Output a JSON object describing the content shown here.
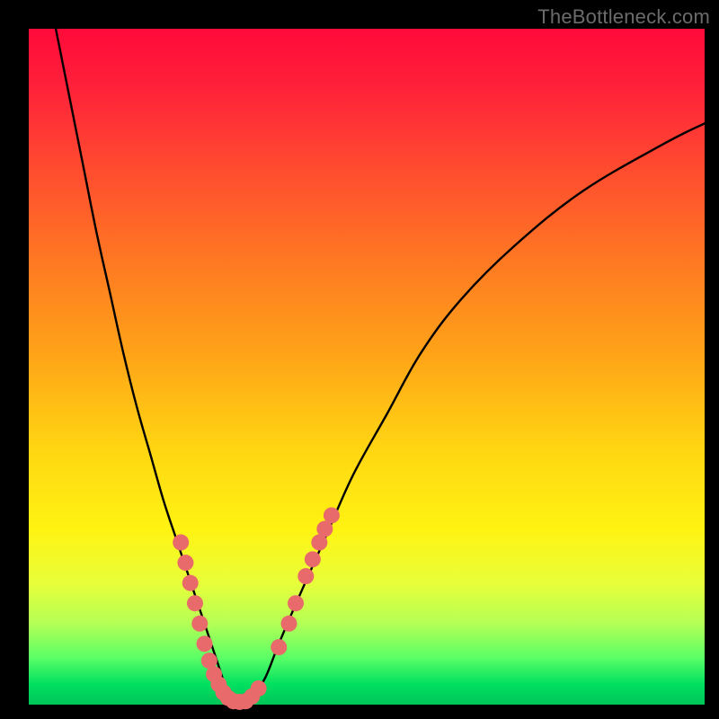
{
  "watermark": "TheBottleneck.com",
  "chart_data": {
    "type": "line",
    "title": "",
    "xlabel": "",
    "ylabel": "",
    "xlim": [
      0,
      100
    ],
    "ylim": [
      0,
      100
    ],
    "series": [
      {
        "name": "bottleneck-curve",
        "x": [
          4,
          6,
          8,
          10,
          12,
          14,
          16,
          18,
          20,
          22,
          24,
          26,
          27,
          28,
          29,
          30,
          31,
          32,
          33,
          35,
          37,
          40,
          44,
          48,
          53,
          58,
          64,
          72,
          82,
          94,
          100
        ],
        "y": [
          100,
          90,
          80,
          70,
          61,
          52,
          44,
          37,
          30,
          24,
          18,
          12,
          9,
          6,
          3,
          1,
          0,
          0,
          1,
          4,
          9,
          16,
          25,
          34,
          43,
          52,
          60,
          68,
          76,
          83,
          86
        ]
      }
    ],
    "markers": {
      "name": "highlight-dots",
      "color": "#e96a6a",
      "radius_px": 9,
      "points": [
        {
          "x": 22.5,
          "y": 24
        },
        {
          "x": 23.2,
          "y": 21
        },
        {
          "x": 23.9,
          "y": 18
        },
        {
          "x": 24.6,
          "y": 15
        },
        {
          "x": 25.3,
          "y": 12
        },
        {
          "x": 26.0,
          "y": 9
        },
        {
          "x": 26.7,
          "y": 6.5
        },
        {
          "x": 27.4,
          "y": 4.5
        },
        {
          "x": 28.1,
          "y": 3
        },
        {
          "x": 28.8,
          "y": 1.8
        },
        {
          "x": 29.5,
          "y": 1
        },
        {
          "x": 30.3,
          "y": 0.5
        },
        {
          "x": 31.2,
          "y": 0.4
        },
        {
          "x": 32.1,
          "y": 0.5
        },
        {
          "x": 33.0,
          "y": 1.2
        },
        {
          "x": 34.0,
          "y": 2.4
        },
        {
          "x": 37.0,
          "y": 8.5
        },
        {
          "x": 38.5,
          "y": 12
        },
        {
          "x": 39.5,
          "y": 15
        },
        {
          "x": 41.0,
          "y": 19
        },
        {
          "x": 42.0,
          "y": 21.5
        },
        {
          "x": 43.0,
          "y": 24
        },
        {
          "x": 43.8,
          "y": 26
        },
        {
          "x": 44.8,
          "y": 28
        }
      ]
    }
  }
}
